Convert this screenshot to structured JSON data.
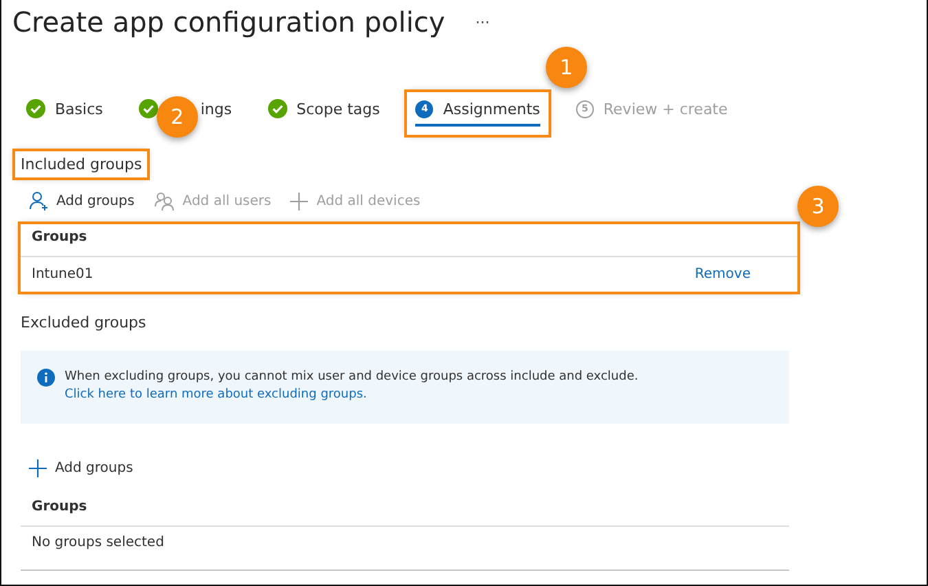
{
  "title": "Create app configuration policy",
  "more": "···",
  "steps": [
    {
      "label": "Basics",
      "kind": "done",
      "selected": false
    },
    {
      "label": "ings",
      "kind": "done",
      "selected": false,
      "callout": "2"
    },
    {
      "label": "Scope tags",
      "kind": "done",
      "selected": false
    },
    {
      "label": "Assignments",
      "kind": "current",
      "number": "4",
      "selected": true,
      "highlighted": true,
      "callout": "1"
    },
    {
      "label": "Review + create",
      "kind": "upcoming",
      "number": "5",
      "selected": false
    }
  ],
  "included": {
    "heading": "Included groups",
    "highlighted": true,
    "actions": [
      {
        "label": "Add groups",
        "kind": "person-add",
        "disabled": false
      },
      {
        "label": "Add all users",
        "kind": "people",
        "disabled": true
      },
      {
        "label": "Add all devices",
        "kind": "plus",
        "disabled": true
      }
    ],
    "table": {
      "highlighted": true,
      "callout": "3",
      "column": "Groups",
      "rows": [
        {
          "name": "Intune01",
          "action": "Remove"
        }
      ]
    }
  },
  "excluded": {
    "heading": "Excluded groups",
    "info": {
      "text": "When excluding groups, you cannot mix user and device groups across include and exclude.",
      "link": "Click here to learn more about excluding groups."
    },
    "actions": [
      {
        "label": "Add groups",
        "kind": "plus",
        "disabled": false
      }
    ],
    "table": {
      "column": "Groups",
      "empty": "No groups selected"
    }
  }
}
